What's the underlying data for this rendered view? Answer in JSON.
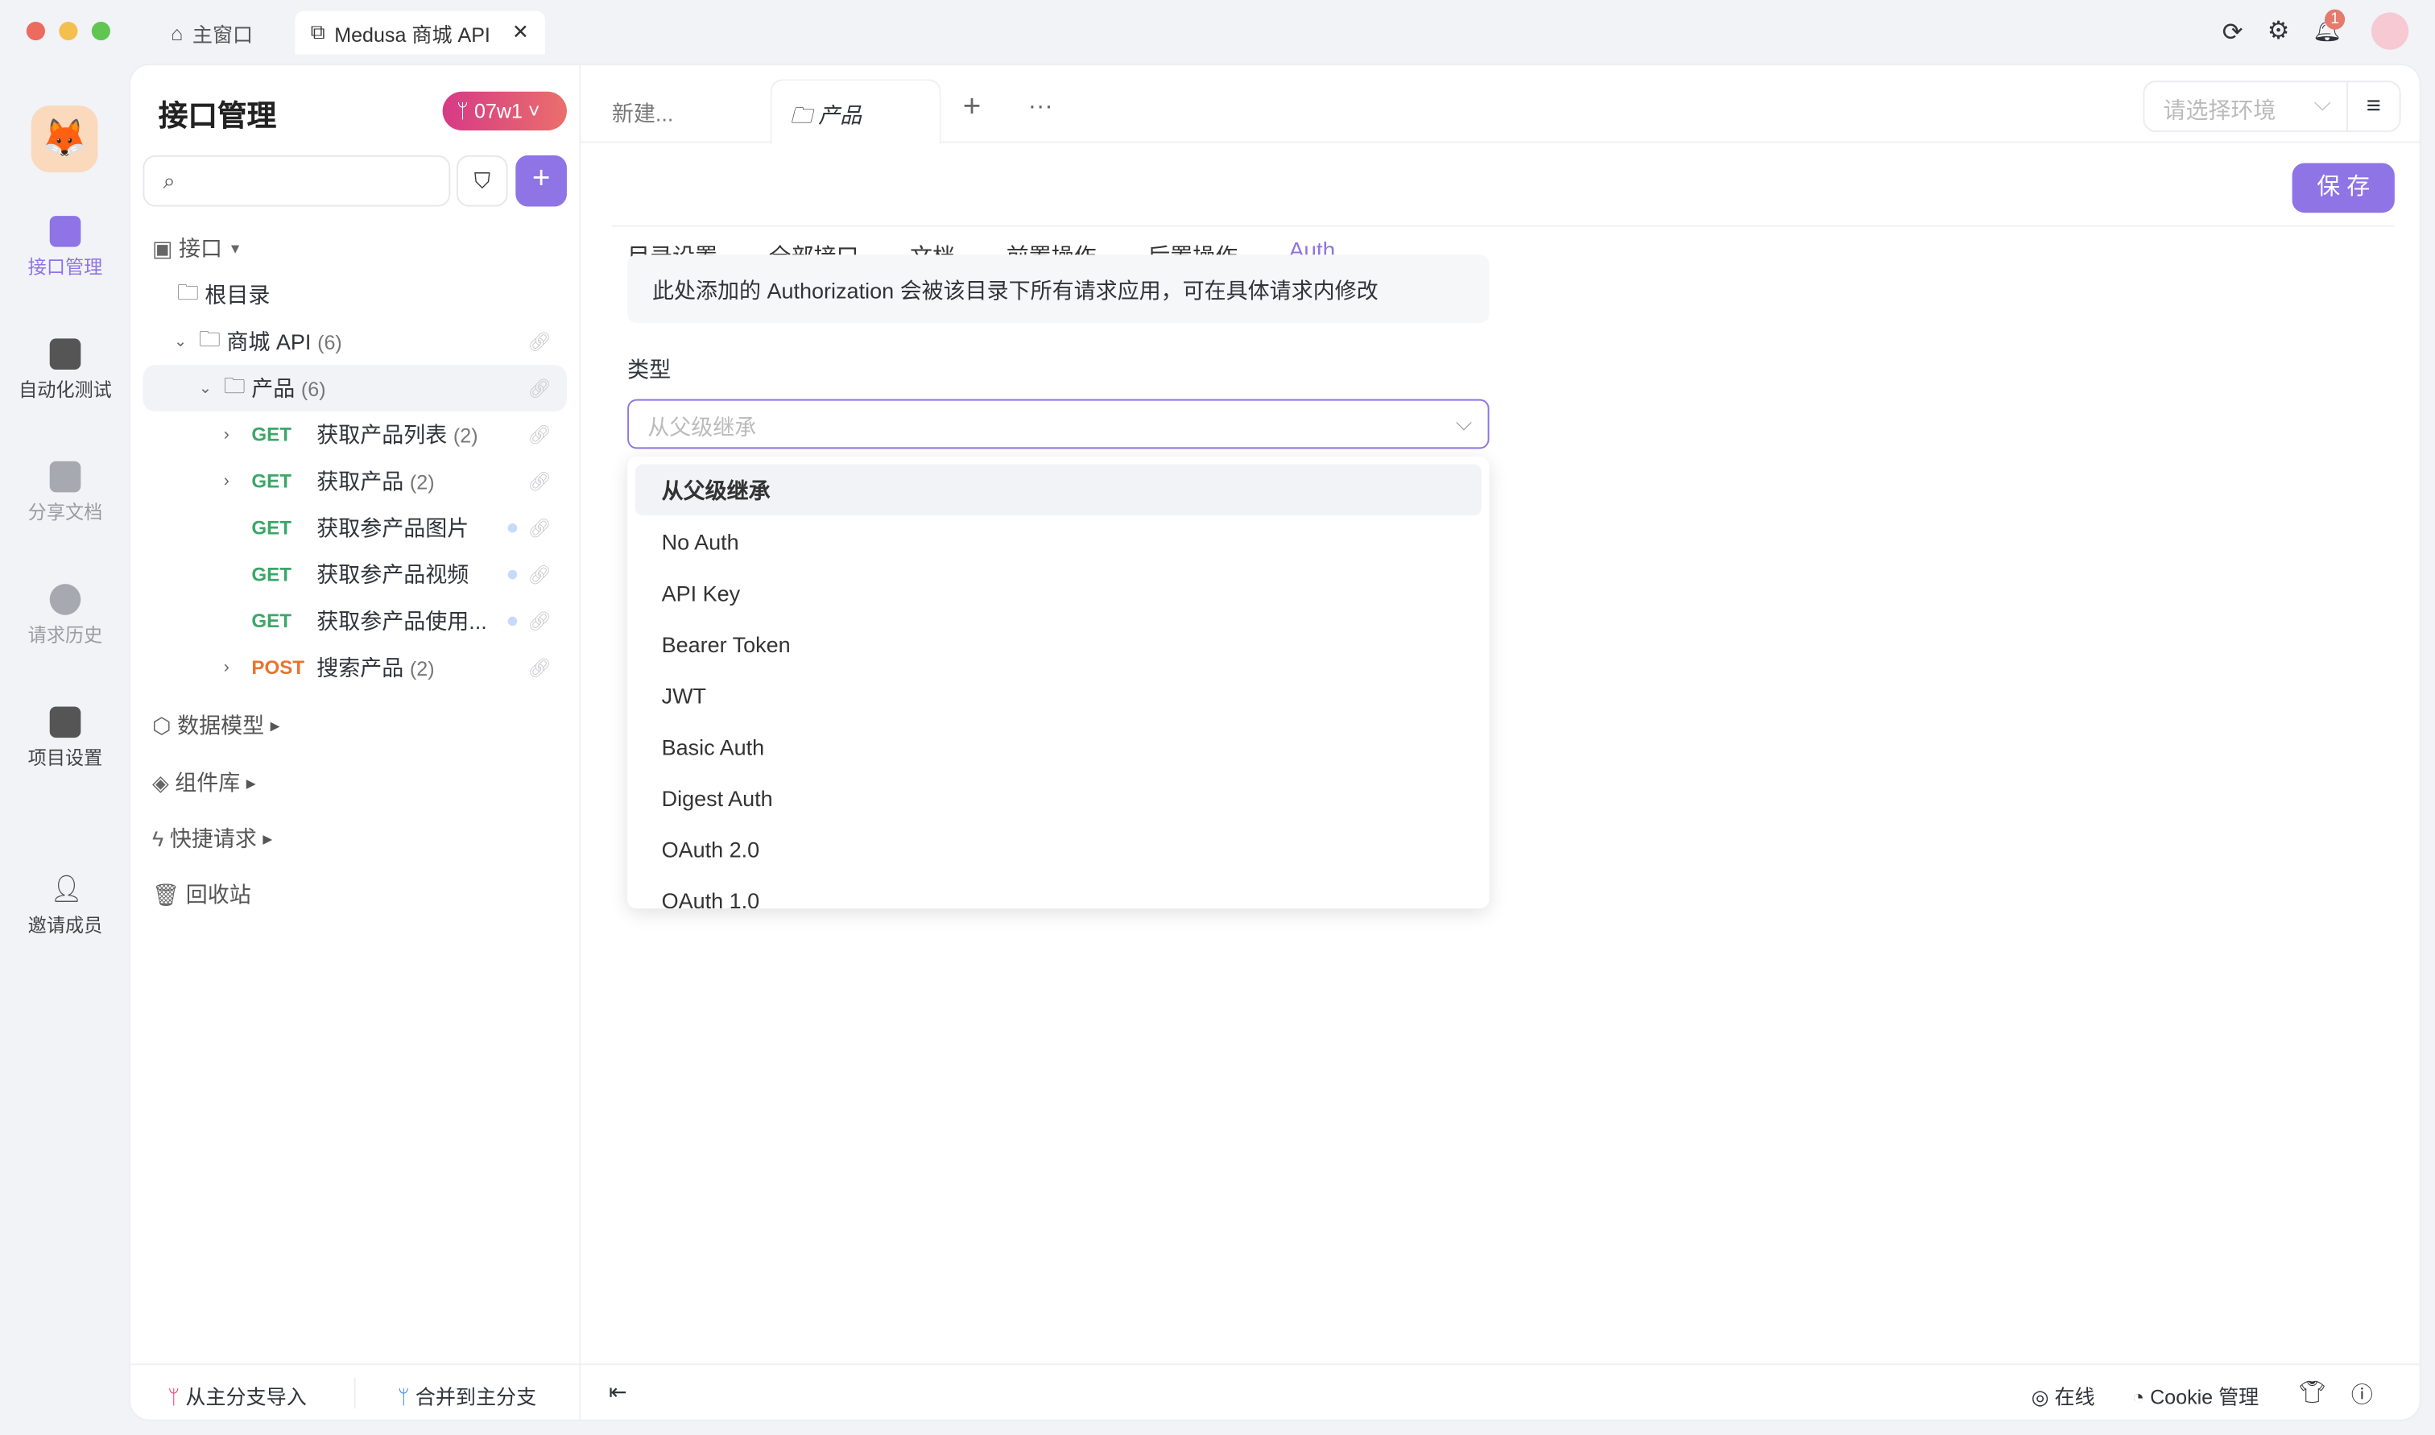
{
  "titlebar": {
    "home_tab": "主窗口",
    "active_tab": "Medusa 商城 API",
    "notification_count": "1"
  },
  "rail": [
    {
      "label": "接口管理",
      "active": true
    },
    {
      "label": "自动化测试"
    },
    {
      "label": "分享文档"
    },
    {
      "label": "请求历史"
    },
    {
      "label": "项目设置"
    },
    {
      "label": "邀请成员"
    }
  ],
  "sidebar": {
    "title": "接口管理",
    "branch": "07w1",
    "search_placeholder": "",
    "root_label": "接口",
    "root_dir": "根目录",
    "tree": [
      {
        "label": "商城 API",
        "count": "(6)"
      },
      {
        "label": "产品",
        "count": "(6)"
      }
    ],
    "apis": [
      {
        "method": "GET",
        "name": "获取产品列表",
        "count": "(2)",
        "expand": true
      },
      {
        "method": "GET",
        "name": "获取产品",
        "count": "(2)",
        "expand": true
      },
      {
        "method": "GET",
        "name": "获取参产品图片",
        "count": "",
        "dot": true
      },
      {
        "method": "GET",
        "name": "获取参产品视频",
        "count": "",
        "dot": true
      },
      {
        "method": "GET",
        "name": "获取参产品使用...",
        "count": "",
        "dot": true
      },
      {
        "method": "POST",
        "name": "搜索产品",
        "count": "(2)",
        "expand": true
      }
    ],
    "sections": [
      "数据模型",
      "组件库",
      "快捷请求",
      "回收站"
    ],
    "footer": {
      "import": "从主分支导入",
      "merge": "合并到主分支"
    }
  },
  "tabs": {
    "open": [
      "新建...",
      "产品"
    ],
    "env_placeholder": "请选择环境"
  },
  "subtabs": [
    "目录设置",
    "全部接口",
    "文档",
    "前置操作",
    "后置操作",
    "Auth"
  ],
  "save_label": "保 存",
  "auth": {
    "notice": "此处添加的 Authorization 会被该目录下所有请求应用，可在具体请求内修改",
    "type_label": "类型",
    "select_placeholder": "从父级继承",
    "options": [
      "从父级继承",
      "No Auth",
      "API Key",
      "Bearer Token",
      "JWT",
      "Basic Auth",
      "Digest Auth",
      "OAuth 2.0",
      "OAuth 1.0"
    ]
  },
  "statusbar": {
    "online": "在线",
    "cookie": "Cookie 管理"
  },
  "colors": {
    "accent": "#8f74e6",
    "get": "#3aa768",
    "post": "#e8742f"
  }
}
